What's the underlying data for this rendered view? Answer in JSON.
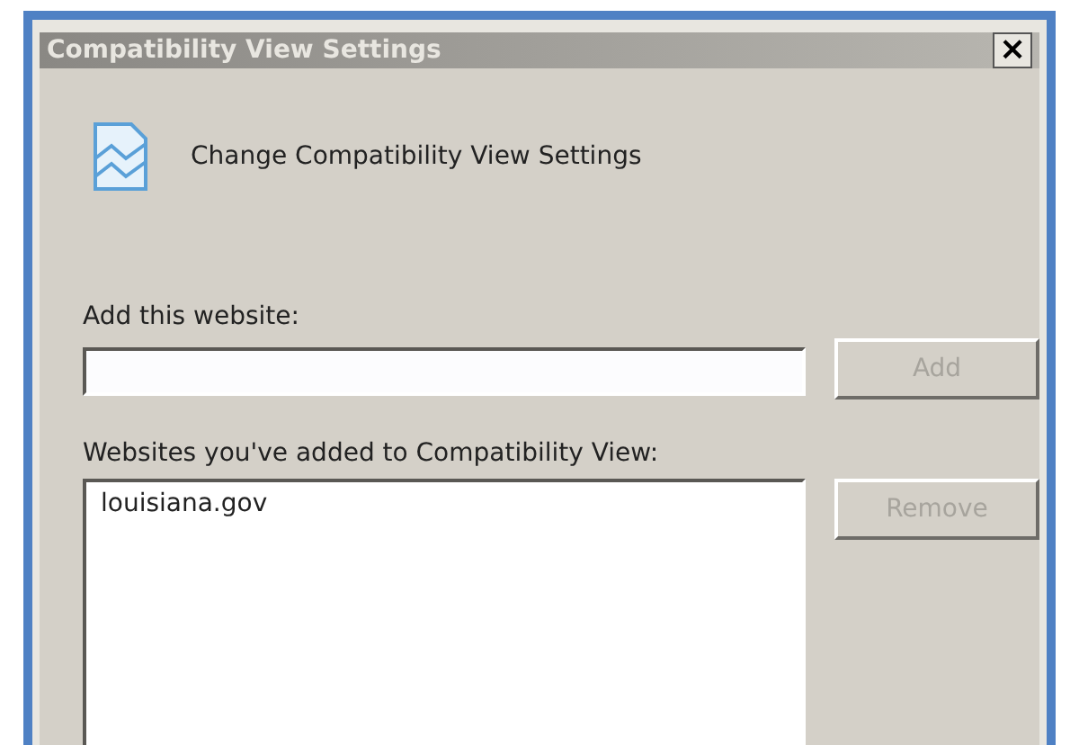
{
  "window": {
    "title": "Compatibility View Settings",
    "close": "×"
  },
  "heading": "Change Compatibility View Settings",
  "add_field": {
    "label": "Add this website:"
  },
  "add_button": {
    "label": "Add",
    "disabled": true
  },
  "list": {
    "label": "Websites you've added to Compatibility View:",
    "items": [
      {
        "text": "louisiana.gov",
        "selected": false
      }
    ]
  },
  "remove_button": {
    "label": "Remove",
    "disabled": true
  }
}
